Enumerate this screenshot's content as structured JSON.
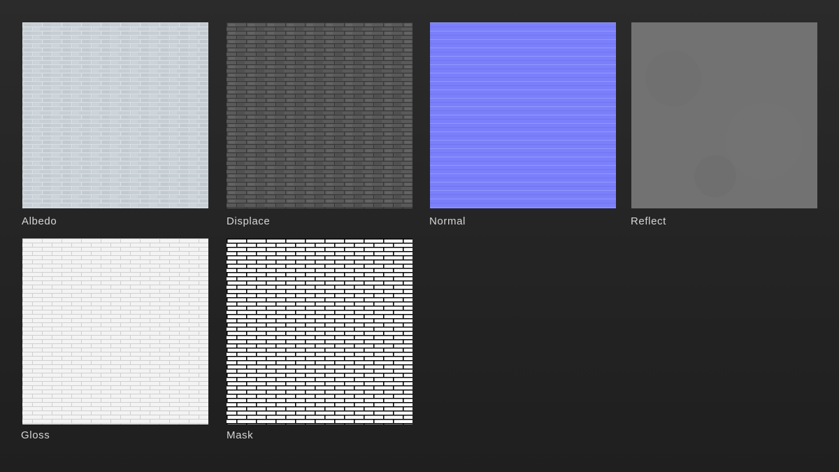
{
  "maps": [
    {
      "label": "Albedo",
      "base_color": "#c3cbd2",
      "mortar_color": "#d6dde2"
    },
    {
      "label": "Displace",
      "base_color": "#565656",
      "mortar_color": "#3a3a3a"
    },
    {
      "label": "Normal",
      "base_color": "#7c80fb",
      "mortar_color": "#8c90ff"
    },
    {
      "label": "Reflect",
      "base_color": "#737373",
      "mortar_color": "#6d6d6d"
    },
    {
      "label": "Gloss",
      "base_color": "#f3f3f3",
      "mortar_color": "#d0d0d0"
    },
    {
      "label": "Mask",
      "base_color": "#ffffff",
      "mortar_color": "#000000"
    }
  ]
}
